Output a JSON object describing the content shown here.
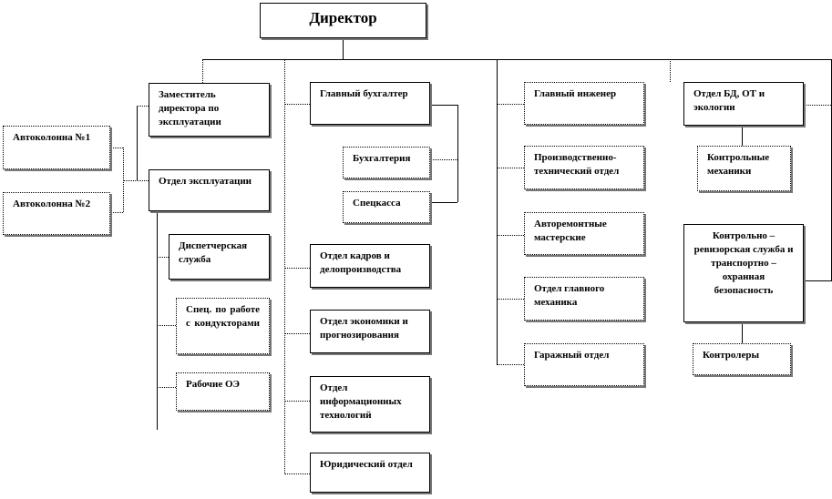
{
  "director": "Директор",
  "left": {
    "deputy": "Заместитель директора по эксплуатации",
    "column1": "Автоколонна №1",
    "column2": "Автоколонна №2",
    "operations": "Отдел эксплуатации",
    "dispatch": "Диспетчерская служба",
    "conductors": "Спец. по работе с кондукторами",
    "workers": "Рабочие ОЭ"
  },
  "accounting": {
    "chief": "Главный бухгалтер",
    "bookkeeping": "Бухгалтерия",
    "cashdesk": "Спецкасса",
    "hr": "Отдел кадров и делопроизводства",
    "economics": "Отдел экономики и прогнозирования",
    "it": "Отдел информационных технологий",
    "legal": "Юридический отдел"
  },
  "engineering": {
    "chief": "Главный инженер",
    "production": "Производственно-технический отдел",
    "repair": "Авторемонтные мастерские",
    "mechanic": "Отдел главного механика",
    "garage": "Гаражный отдел"
  },
  "safety": {
    "dept": "Отдел БД, ОТ и экологии",
    "mechanics": "Контрольные механики",
    "audit": "Контрольно – ревизорская служба и транспортно – охранная безопасность",
    "inspectors": "Контролеры"
  }
}
